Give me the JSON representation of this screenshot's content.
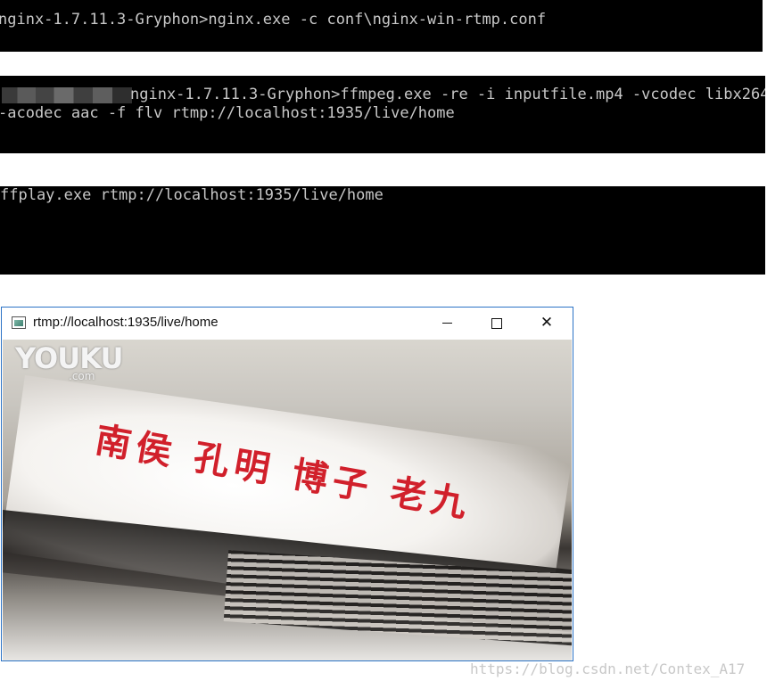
{
  "terminals": [
    {
      "lines": [
        "nginx-1.7.11.3-Gryphon>nginx.exe -c conf\\nginx-win-rtmp.conf"
      ]
    },
    {
      "lines": [
        "nginx-1.7.11.3-Gryphon>ffmpeg.exe -re -i inputfile.mp4 -vcodec libx264",
        "-acodec aac -f flv rtmp://localhost:1935/live/home"
      ]
    },
    {
      "lines": [
        "ffplay.exe rtmp://localhost:1935/live/home"
      ]
    }
  ],
  "player": {
    "title": "rtmp://localhost:1935/live/home",
    "minimize_icon": "minimize-icon",
    "maximize_icon": "maximize-icon",
    "close_icon": "close-icon",
    "close_glyph": "✕",
    "logo_text": "YOUKU",
    "logo_sub": ".com",
    "video_caption": "南侯 孔明 博子 老九"
  },
  "watermark": "https://blog.csdn.net/Contex_A17",
  "colors": {
    "terminal_bg": "#000000",
    "terminal_text": "#c8c8c8",
    "window_border": "#2b73c6",
    "caption_red": "#d1202b"
  }
}
